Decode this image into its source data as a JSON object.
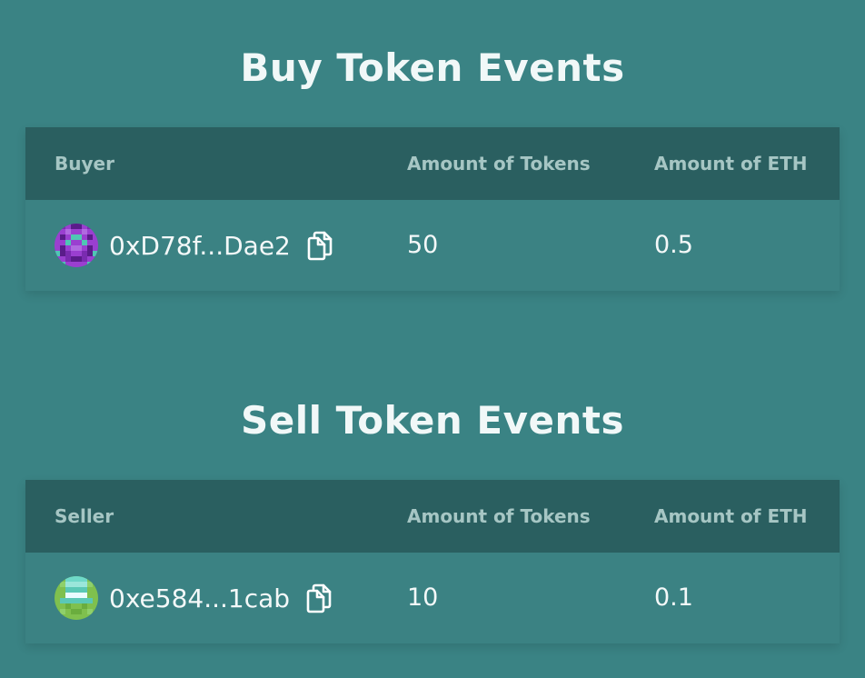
{
  "buy_section": {
    "title": "Buy Token Events",
    "headers": {
      "address": "Buyer",
      "tokens": "Amount of Tokens",
      "eth": "Amount of ETH"
    },
    "rows": [
      {
        "address": "0xD78f...Dae2",
        "avatar_icon": "purple-pixel-avatar-icon",
        "tokens": "50",
        "eth": "0.5"
      }
    ]
  },
  "sell_section": {
    "title": "Sell Token Events",
    "headers": {
      "address": "Seller",
      "tokens": "Amount of Tokens",
      "eth": "Amount of ETH"
    },
    "rows": [
      {
        "address": "0xe584...1cab",
        "avatar_icon": "green-pixel-avatar-icon",
        "tokens": "10",
        "eth": "0.1"
      }
    ]
  },
  "icons": {
    "copy": "copy-icon"
  },
  "colors": {
    "background": "#3a8384",
    "header_bg": "#2a5f60",
    "header_text": "#a6c6c4",
    "text": "#f3f8f8"
  }
}
